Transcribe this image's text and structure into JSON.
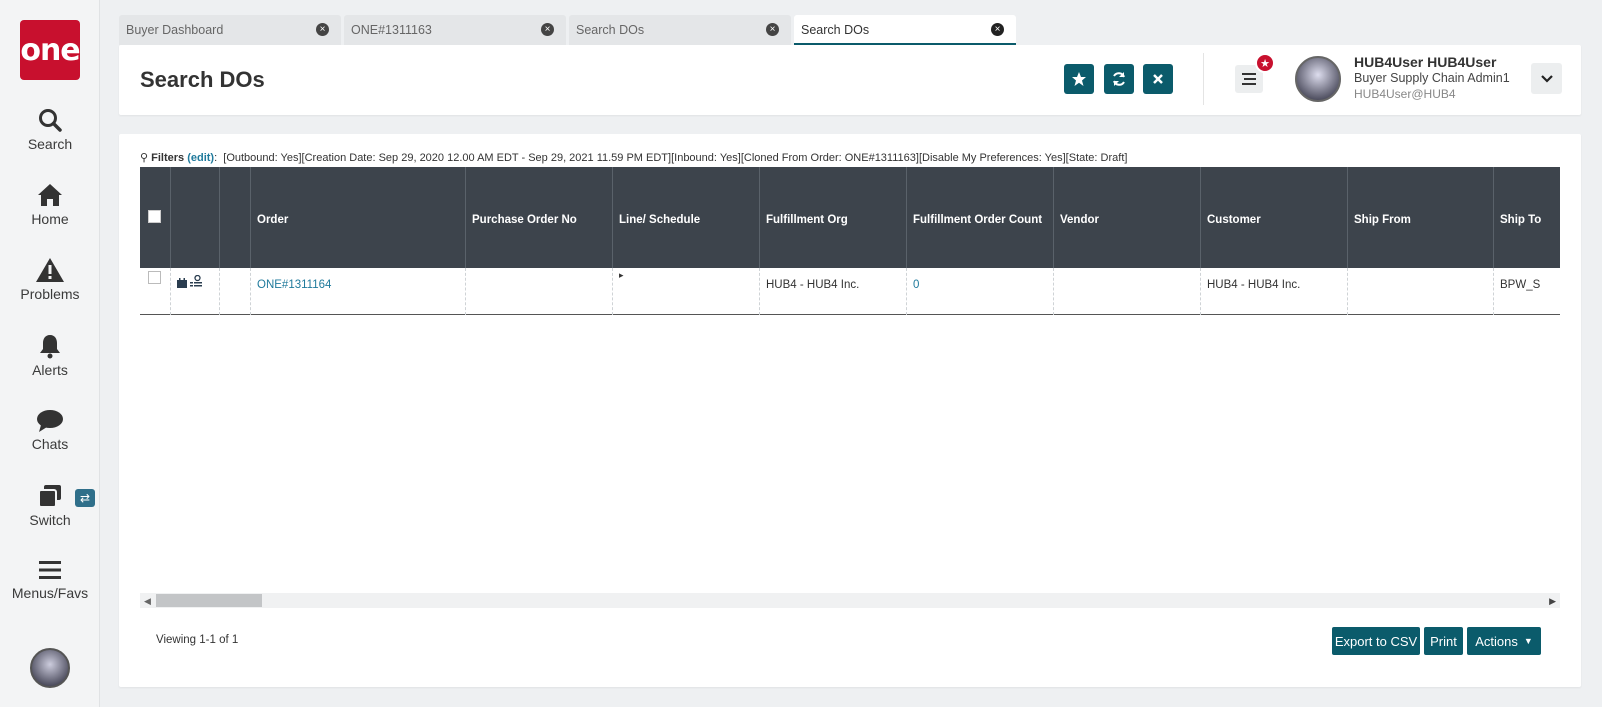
{
  "app": {
    "logo_text": "one",
    "brand_color": "#c8102e",
    "accent_color": "#0b5b6b"
  },
  "rail": {
    "items": [
      {
        "label": "Search",
        "icon": "search-icon"
      },
      {
        "label": "Home",
        "icon": "home-icon"
      },
      {
        "label": "Problems",
        "icon": "warning-icon"
      },
      {
        "label": "Alerts",
        "icon": "bell-icon"
      },
      {
        "label": "Chats",
        "icon": "chat-icon"
      },
      {
        "label": "Switch",
        "icon": "switch-icon"
      },
      {
        "label": "Menus/Favs",
        "icon": "hamburger-icon"
      }
    ]
  },
  "tabs": [
    {
      "label": "Buyer Dashboard"
    },
    {
      "label": "ONE#1311163"
    },
    {
      "label": "Search DOs"
    },
    {
      "label": "Search DOs"
    }
  ],
  "header": {
    "title": "Search DOs",
    "user": {
      "name": "HUB4User HUB4User",
      "role": "Buyer Supply Chain Admin1",
      "email": "HUB4User@HUB4"
    }
  },
  "filters": {
    "label": "Filters",
    "edit_label": "(edit)",
    "text": "[Outbound: Yes][Creation Date: Sep 29, 2020 12.00 AM EDT - Sep 29, 2021 11.59 PM EDT][Inbound: Yes][Cloned From Order: ONE#1311163][Disable My Preferences: Yes][State: Draft]"
  },
  "grid": {
    "columns": [
      "",
      "",
      "",
      "Order",
      "Purchase Order No",
      "Line/ Schedule",
      "Fulfillment Org",
      "Fulfillment Order Count",
      "Vendor",
      "Customer",
      "Ship From",
      "Ship To"
    ],
    "rows": [
      {
        "order": "ONE#1311164",
        "purchase_order_no": "",
        "line_schedule": "▸",
        "fulfillment_org": "HUB4 - HUB4 Inc.",
        "fulfillment_order_count": "0",
        "vendor": "",
        "customer": "HUB4 - HUB4 Inc.",
        "ship_from": "",
        "ship_to": "BPW_S"
      }
    ]
  },
  "footer": {
    "viewing": "Viewing 1-1 of 1",
    "export_label": "Export to CSV",
    "print_label": "Print",
    "actions_label": "Actions"
  }
}
